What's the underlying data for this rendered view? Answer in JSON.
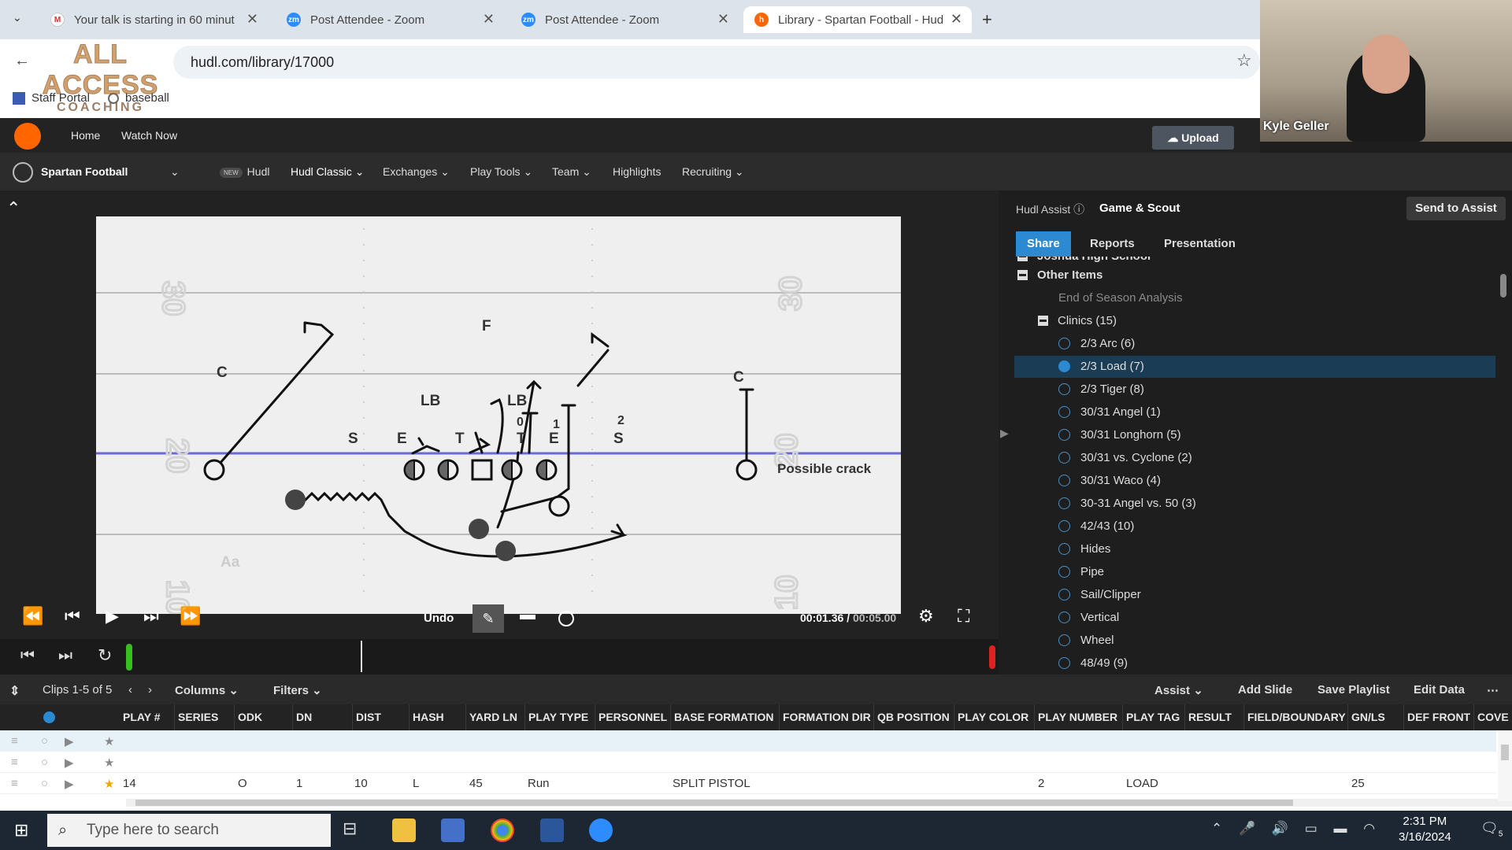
{
  "tabs": [
    {
      "title": "Your talk is starting in 60 minut",
      "icon": "gmail-icon",
      "color": "#d93025",
      "glyph": "M",
      "active": false
    },
    {
      "title": "Post Attendee - Zoom",
      "icon": "zoom-icon",
      "color": "#2d8cff",
      "glyph": "zm",
      "active": false
    },
    {
      "title": "Post Attendee - Zoom",
      "icon": "zoom-icon",
      "color": "#2d8cff",
      "glyph": "zm",
      "active": false
    },
    {
      "title": "Library - Spartan Football - Hud",
      "icon": "hudl-icon",
      "color": "#ff6600",
      "glyph": "h",
      "active": true
    }
  ],
  "browser": {
    "url": "hudl.com/library/17000",
    "bookmarks": [
      "Staff Portal",
      "baseball"
    ],
    "watermark": [
      "ALL ACCESS",
      "COACHING"
    ]
  },
  "webcam": {
    "name": "Kyle Geller"
  },
  "topnav": {
    "links": [
      "Home",
      "Watch Now"
    ],
    "upload": "Upload"
  },
  "subnav": {
    "team": "Spartan Football",
    "badge": "NEW",
    "items": [
      "Hudl",
      "Hudl Classic",
      "Exchanges",
      "Play Tools",
      "Team",
      "Highlights",
      "Recruiting"
    ]
  },
  "play": {
    "yard_numbers": [
      "30",
      "20",
      "30",
      "20",
      "10",
      "10"
    ],
    "labels": [
      "C",
      "F",
      "LB",
      "LB",
      "S",
      "E",
      "T",
      "0",
      "T",
      "1",
      "E",
      "2",
      "S",
      "C",
      "Aa"
    ],
    "annotation": "Possible crack"
  },
  "player": {
    "undo": "Undo",
    "time_current": "00:01.36",
    "time_sep": " / ",
    "time_total": "00:05.00",
    "progress": 0.27
  },
  "panel": {
    "assist": "Hudl Assist",
    "title": "Game & Scout",
    "send": "Send to Assist",
    "tabs": [
      "Share",
      "Reports",
      "Presentation"
    ],
    "partial_item": "Joshua High School",
    "other_items": "Other Items",
    "end_season": "End of Season Analysis",
    "clinics": "Clinics (15)",
    "clinic_items": [
      "2/3 Arc (6)",
      "2/3 Load (7)",
      "2/3 Tiger (8)",
      "30/31 Angel (1)",
      "30/31 Longhorn (5)",
      "30/31 vs. Cyclone (2)",
      "30/31 Waco (4)",
      "30-31 Angel vs. 50 (3)",
      "42/43 (10)",
      "Hides",
      "Pipe",
      "Sail/Clipper",
      "Vertical",
      "Wheel",
      "48/49 (9)"
    ],
    "selected_index": 1
  },
  "toolbar": {
    "clips": "Clips 1-5 of 5",
    "columns": "Columns",
    "filters": "Filters",
    "assist": "Assist",
    "add_slide": "Add Slide",
    "save_playlist": "Save Playlist",
    "edit_data": "Edit Data"
  },
  "grid": {
    "headers": [
      "PLAY #",
      "SERIES",
      "ODK",
      "DN",
      "DIST",
      "HASH",
      "YARD LN",
      "PLAY TYPE",
      "PERSONNEL",
      "BASE FORMATION",
      "FORMATION DIR",
      "QB POSITION",
      "PLAY COLOR",
      "PLAY NUMBER",
      "PLAY TAG",
      "RESULT",
      "FIELD/BOUNDARY",
      "GN/LS",
      "DEF FRONT",
      "COVE"
    ],
    "rows": [
      {
        "play": "",
        "odk": "",
        "dn": "",
        "dist": "",
        "hash": "",
        "yard": "",
        "type": "",
        "formation": "",
        "number": "",
        "tag": "",
        "gnls": ""
      },
      {
        "play": "",
        "odk": "",
        "dn": "",
        "dist": "",
        "hash": "",
        "yard": "",
        "type": "",
        "formation": "",
        "number": "",
        "tag": "",
        "gnls": ""
      },
      {
        "play": "14",
        "odk": "O",
        "dn": "1",
        "dist": "10",
        "hash": "L",
        "yard": "45",
        "type": "Run",
        "formation": "SPLIT PISTOL",
        "number": "2",
        "tag": "LOAD",
        "gnls": "25"
      }
    ]
  },
  "taskbar": {
    "search": "Type here to search",
    "time": "2:31 PM",
    "date": "3/16/2024",
    "notifications": "5"
  }
}
